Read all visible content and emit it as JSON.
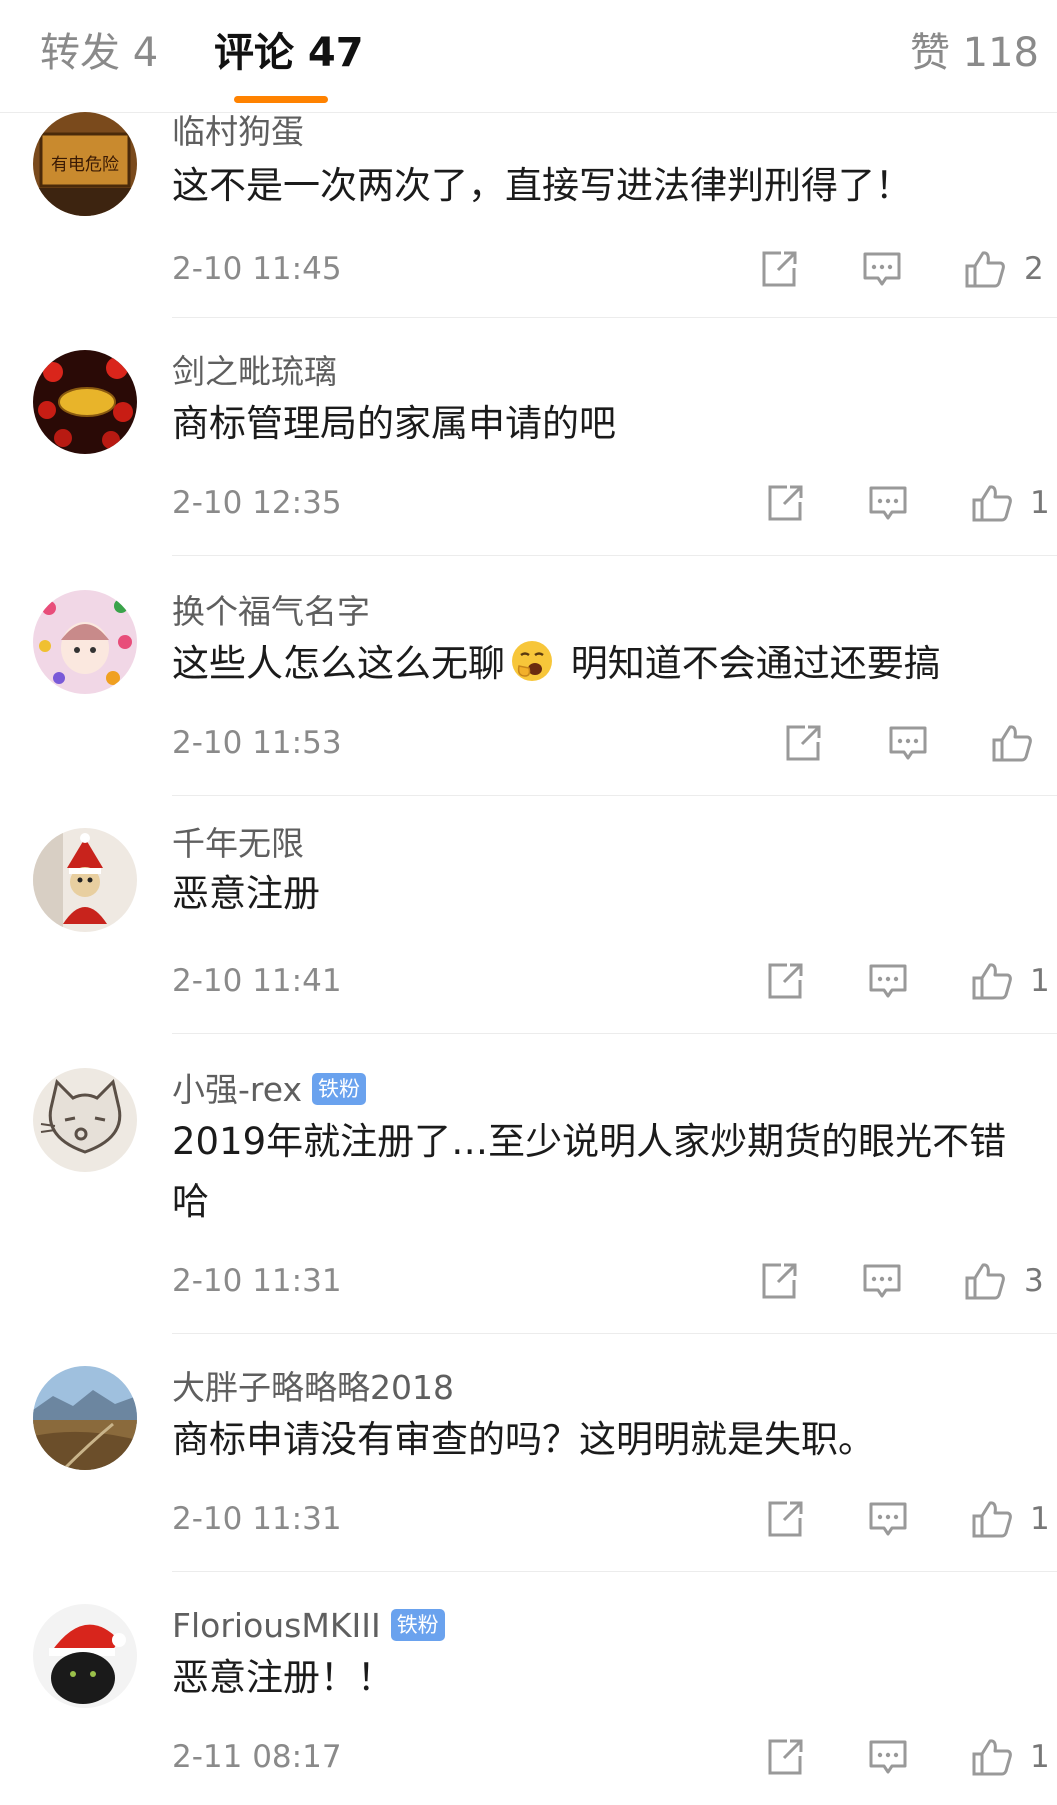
{
  "tabs": [
    {
      "label": "转发 4"
    },
    {
      "label": "评论 47"
    },
    {
      "label": "赞 118"
    }
  ],
  "accent_color": "#ff8200",
  "badge_color": "#6aa2ee",
  "icons": {
    "share": "share-icon",
    "reply": "comment-icon",
    "like": "thumbs-up-icon"
  },
  "comments": [
    {
      "name": "临村狗蛋",
      "text": "这不是一次两次了，直接写进法律判刑得了！",
      "time": "2-10 11:45",
      "likes": "2"
    },
    {
      "name": "剑之毗琉璃",
      "text": "商标管理局的家属申请的吧",
      "time": "2-10 12:35",
      "likes": "1"
    },
    {
      "name": "换个福气名字",
      "text_before": "这些人怎么这么无聊",
      "emoji": "yawn-emoji",
      "text_after": " 明知道不会通过还要搞",
      "time": "2-10 11:53",
      "likes": ""
    },
    {
      "name": "千年无限",
      "text": "恶意注册",
      "time": "2-10 11:41",
      "likes": "1"
    },
    {
      "name": "小强-rex",
      "badge": "铁粉",
      "text": "2019年就注册了…至少说明人家炒期货的眼光不错哈",
      "time": "2-10 11:31",
      "likes": "3"
    },
    {
      "name": "大胖子略略略2018",
      "text": "商标申请没有审查的吗？这明明就是失职。",
      "time": "2-10 11:31",
      "likes": "1"
    },
    {
      "name": "FloriousMKIII",
      "badge": "铁粉",
      "text": "恶意注册！！",
      "time": "2-11 08:17",
      "likes": "1"
    }
  ]
}
